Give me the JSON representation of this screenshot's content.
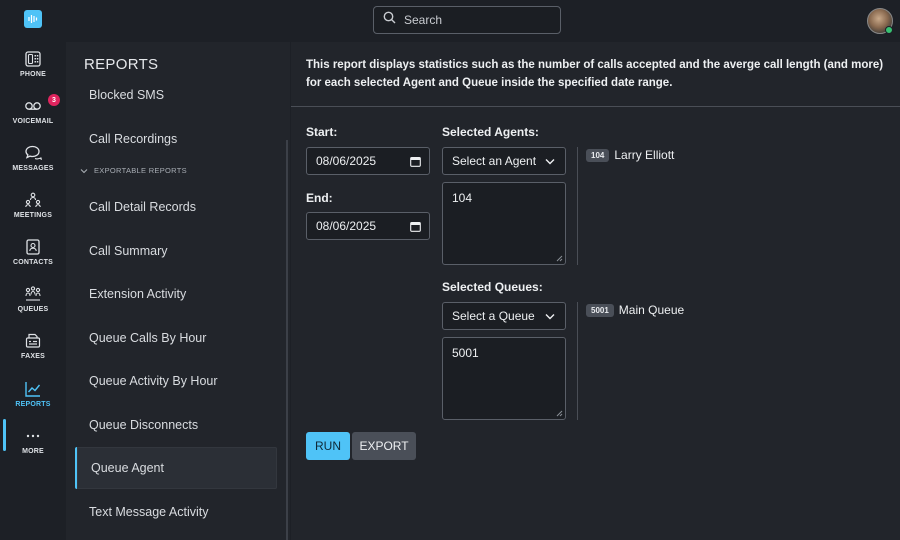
{
  "topbar": {
    "search_placeholder": "Search",
    "search_icon": "search-icon",
    "logo_icon": "waveform-logo-icon"
  },
  "nav": {
    "items": [
      {
        "label": "PHONE",
        "icon": "phone-icon"
      },
      {
        "label": "VOICEMAIL",
        "icon": "voicemail-icon",
        "badge": "3"
      },
      {
        "label": "MESSAGES",
        "icon": "messages-icon"
      },
      {
        "label": "MEETINGS",
        "icon": "meetings-icon"
      },
      {
        "label": "CONTACTS",
        "icon": "contacts-icon"
      },
      {
        "label": "QUEUES",
        "icon": "queues-icon"
      },
      {
        "label": "FAXES",
        "icon": "fax-icon"
      },
      {
        "label": "REPORTS",
        "icon": "reports-chart-icon",
        "active": true
      },
      {
        "label": "MORE",
        "icon": "more-dots-icon"
      }
    ],
    "accent": "#4fc3f7"
  },
  "sidebar": {
    "title": "REPORTS",
    "section_label": "EXPORTABLE REPORTS",
    "items": [
      "Blocked SMS",
      "Call Recordings",
      "Call Detail Records",
      "Call Summary",
      "Extension Activity",
      "Queue Calls By Hour",
      "Queue Activity By Hour",
      "Queue Disconnects",
      "Queue Agent",
      "Text Message Activity"
    ],
    "active_item": "Queue Agent"
  },
  "main": {
    "description": "This report displays statistics such as the number of calls accepted and the averge call length (and more) for each selected Agent and Queue inside the specified date range.",
    "start_label": "Start:",
    "start_value": "08/06/2025",
    "end_label": "End:",
    "end_value": "08/06/2025",
    "agents_label": "Selected Agents:",
    "agents_select": "Select an Agent",
    "agents_text": "104",
    "agent_chip": "104",
    "agent_name": "Larry Elliott",
    "queues_label": "Selected Queues:",
    "queues_select": "Select a Queue",
    "queues_text": "5001",
    "queue_chip": "5001",
    "queue_name": "Main Queue",
    "run_label": "RUN",
    "export_label": "EXPORT"
  }
}
